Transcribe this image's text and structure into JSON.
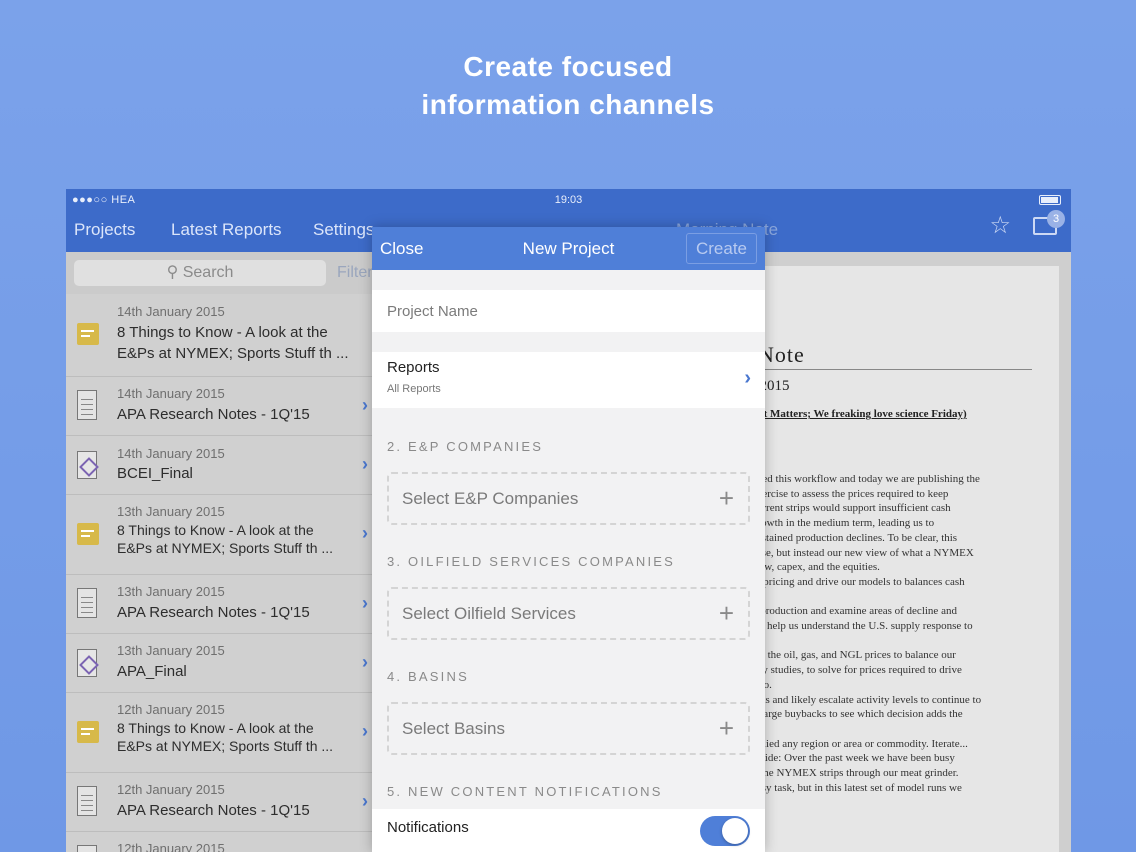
{
  "headline": {
    "line1": "Create focused",
    "line2": "information channels"
  },
  "status": {
    "carrier": "●●●○○ HEA",
    "time": "19:03"
  },
  "nav": {
    "tabs": [
      "Projects",
      "Latest Reports",
      "Settings"
    ],
    "title": "Morning Note",
    "badge": "3"
  },
  "search": {
    "placeholder": "Search",
    "filter": "Filter"
  },
  "list": [
    {
      "date": "14th January 2015",
      "title": "8 Things to Know - A look at the E&Ps at NYMEX; Sports Stuff th ...",
      "icon": "note-icon"
    },
    {
      "date": "14th January 2015",
      "title": "APA Research Notes - 1Q'15",
      "icon": "document-icon"
    },
    {
      "date": "14th January 2015",
      "title": "BCEI_Final",
      "icon": "cube-document-icon"
    },
    {
      "date": "13th January 2015",
      "title": "8 Things to Know - A look at the E&Ps at NYMEX; Sports Stuff th ...",
      "icon": "note-icon"
    },
    {
      "date": "13th January 2015",
      "title": "APA Research Notes - 1Q'15",
      "icon": "document-icon"
    },
    {
      "date": "13th January 2015",
      "title": "APA_Final",
      "icon": "cube-document-icon"
    },
    {
      "date": "12th January 2015",
      "title": "8 Things to Know - A look at the E&Ps at NYMEX; Sports Stuff th ...",
      "icon": "note-icon"
    },
    {
      "date": "12th January 2015",
      "title": "APA Research Notes - 1Q'15",
      "icon": "document-icon"
    },
    {
      "date": "12th January 2015",
      "title": "",
      "icon": "document-icon"
    }
  ],
  "document": {
    "heading": "Note",
    "date": ", 2015",
    "subtitle": "hat Matters; We freaking love science Friday)",
    "lines": [
      "ched this workflow and today we are publishing the",
      "exercise to assess the prices required to keep",
      "current strips would support insufficient cash",
      "growth in the medium term, leading us to",
      "sustained production declines.  To be clear, this",
      "case, but instead our new view of what a NYMEX",
      "flow, capex, and the equities.",
      "ip pricing and drive our models to balances cash",
      "",
      "n production and examine areas of decline and",
      "els help us understand the U.S. supply response to",
      "",
      "for the oil, gas, and NGL prices to balance our",
      "ncy studies, to solve for prices required to drive",
      "ario.",
      "icks and likely escalate activity levels to continue to",
      "g large buybacks to see which decision adds the",
      "",
      "pplied any region or area or commodity. Iterate...",
      "psiide:  Over the past week we have been busy",
      "n the NYMEX strips through our meat grinder.",
      "easy task, but in this latest set of model runs we"
    ]
  },
  "modal": {
    "close": "Close",
    "title": "New Project",
    "create": "Create",
    "project_name_placeholder": "Project Name",
    "reports_label": "Reports",
    "reports_value": "All Reports",
    "section2": "2. E&P COMPANIES",
    "picker2": "Select E&P Companies",
    "section3": "3. OILFIELD SERVICES COMPANIES",
    "picker3": "Select Oilfield Services",
    "section4": "4. BASINS",
    "picker4": "Select Basins",
    "section5": "5. NEW CONTENT NOTIFICATIONS",
    "notifications_label": "Notifications",
    "notifications_on": true
  },
  "colors": {
    "background": "#7ba2ea",
    "navbar": "#3d6bc9",
    "modal_bar": "#4f7fd8",
    "accent": "#4a77cf"
  }
}
